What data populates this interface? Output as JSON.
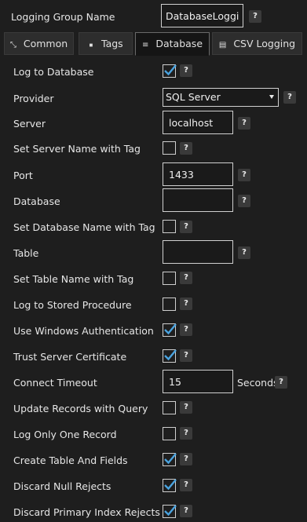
{
  "header": {
    "group_label": "Logging Group Name",
    "group_value": "DatabaseLogging",
    "help": "?"
  },
  "tabs": [
    {
      "label": "Common",
      "icon": "resize-arrows-icon",
      "glyph": "⤡"
    },
    {
      "label": "Tags",
      "icon": "tag-icon",
      "glyph": "◆"
    },
    {
      "label": "Database",
      "icon": "database-icon",
      "glyph": "≡"
    },
    {
      "label": "CSV Logging",
      "icon": "csv-file-icon",
      "glyph": "▤"
    }
  ],
  "active_tab": "Database",
  "fields": {
    "log_to_database": {
      "label": "Log to Database",
      "checked": true
    },
    "provider": {
      "label": "Provider",
      "value": "SQL Server"
    },
    "server": {
      "label": "Server",
      "value": "localhost"
    },
    "server_with_tag": {
      "label": "Set Server Name with Tag",
      "checked": false
    },
    "port": {
      "label": "Port",
      "value": "1433"
    },
    "database": {
      "label": "Database",
      "value": ""
    },
    "database_with_tag": {
      "label": "Set Database Name with Tag",
      "checked": false
    },
    "table": {
      "label": "Table",
      "value": ""
    },
    "table_with_tag": {
      "label": "Set Table Name with Tag",
      "checked": false
    },
    "stored_procedure": {
      "label": "Log to Stored Procedure",
      "checked": false
    },
    "windows_auth": {
      "label": "Use Windows Authentication",
      "checked": true
    },
    "trust_cert": {
      "label": "Trust Server Certificate",
      "checked": true
    },
    "connect_timeout": {
      "label": "Connect Timeout",
      "value": "15",
      "unit": "Seconds"
    },
    "update_with_query": {
      "label": "Update Records with Query",
      "checked": false
    },
    "log_one_record": {
      "label": "Log Only One Record",
      "checked": false
    },
    "create_table": {
      "label": "Create Table And Fields",
      "checked": true
    },
    "discard_null": {
      "label": "Discard Null Rejects",
      "checked": true
    },
    "discard_pk": {
      "label": "Discard Primary Index Rejects",
      "checked": true
    }
  },
  "colors": {
    "accent_check": "#4aa3df",
    "background": "#1e1e1e"
  }
}
